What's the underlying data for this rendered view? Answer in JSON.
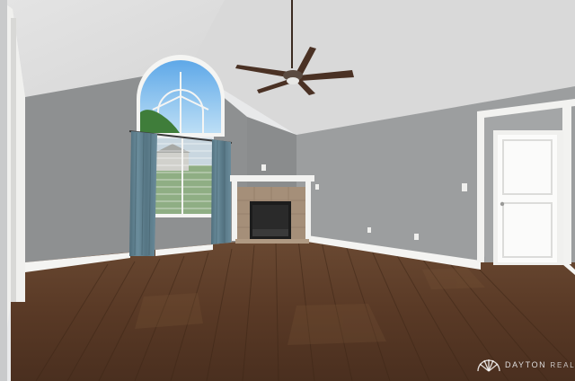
{
  "photo": {
    "scene": "empty-living-room",
    "elements": [
      "vaulted-ceiling",
      "ceiling-fan",
      "arched-window",
      "curtains",
      "corner-fireplace",
      "interior-door",
      "hardwood-floor",
      "baseboards",
      "outlets",
      "light-switch"
    ]
  },
  "watermark": {
    "brand": "DAYTON",
    "suffix": "REALTORS",
    "icon": "shell-logo-icon"
  },
  "colors": {
    "wall": "#8f9192",
    "wall_right": "#9b9d9e",
    "ceiling": "#dcdcdc",
    "floor": "#5a3a25",
    "trim": "#f4f4f2",
    "curtain": "#5f7e8c",
    "sky": "#8ec3ea"
  }
}
